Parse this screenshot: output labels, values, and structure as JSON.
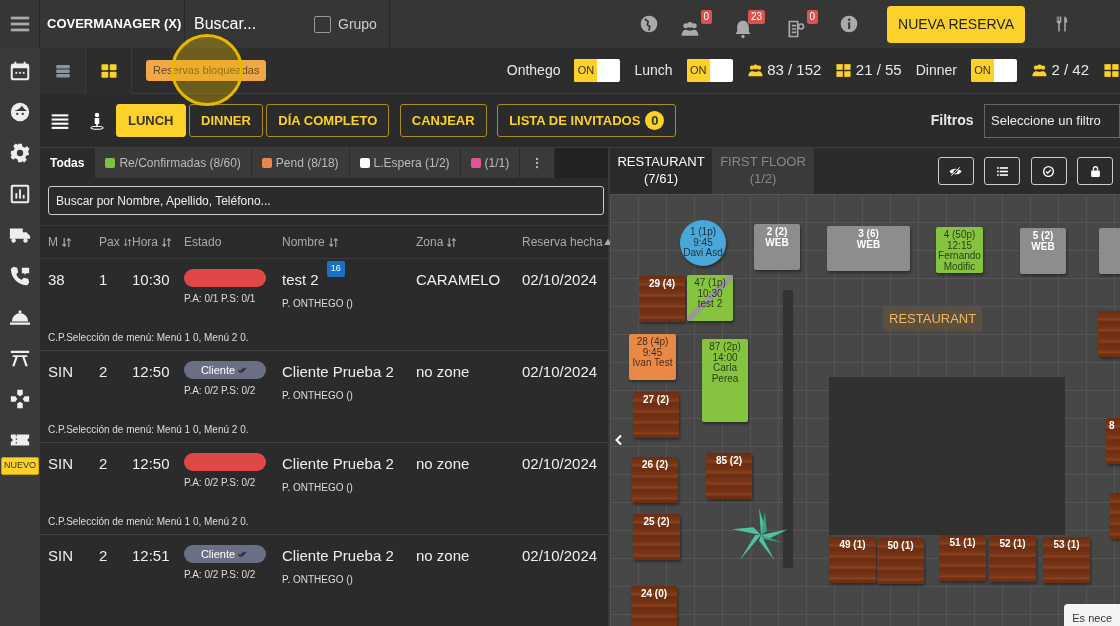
{
  "topbar": {
    "brand": "COVERMANAGER (X)",
    "search": {
      "placeholder": "Buscar..."
    },
    "group": {
      "label": "Grupo",
      "checked": false
    },
    "icons": [
      {
        "kind": "globe"
      },
      {
        "kind": "people",
        "count": "0"
      },
      {
        "kind": "bell",
        "count": "23"
      },
      {
        "kind": "clipboard",
        "count": "0"
      },
      {
        "kind": "info"
      }
    ],
    "new_button": "NUEVA RESERVA"
  },
  "sidebar": {
    "items": [
      {
        "kind": "calendar"
      },
      {
        "kind": "face"
      },
      {
        "kind": "gear"
      },
      {
        "kind": "chart"
      },
      {
        "kind": "truck"
      },
      {
        "kind": "phone"
      },
      {
        "kind": "service-bell"
      },
      {
        "kind": "gate"
      },
      {
        "kind": "puzzle"
      },
      {
        "kind": "ticket",
        "badge": "NUEVO"
      }
    ]
  },
  "toolbar": {
    "views": [
      {
        "kind": "rows",
        "selected": false
      },
      {
        "kind": "grid",
        "selected": true
      }
    ],
    "blocked_tag": "Reservas bloqueadas",
    "services": [
      {
        "label": "Onthego",
        "toggle": "ON",
        "on": true
      },
      {
        "label": "Lunch",
        "toggle": "ON",
        "on": true,
        "stats": [
          {
            "kind": "people",
            "text": "83 / 152"
          },
          {
            "kind": "tables",
            "text": "21 / 55"
          }
        ]
      },
      {
        "label": "Dinner",
        "toggle": "ON",
        "on": true,
        "stats": [
          {
            "kind": "people",
            "text": "2 / 42"
          },
          {
            "kind": "tables"
          }
        ]
      }
    ]
  },
  "shifts": [
    {
      "label": "LUNCH",
      "selected": true
    },
    {
      "label": "DINNER",
      "selected": false
    },
    {
      "label": "DÍA COMPLETO",
      "selected": false
    }
  ],
  "actions": [
    {
      "label": "CANJEAR"
    },
    {
      "label": "LISTA DE INVITADOS",
      "count": "0"
    }
  ],
  "filters": {
    "label": "Filtros",
    "placeholder": "Seleccione un filtro"
  },
  "list": {
    "tabs": [
      {
        "label": "Todas",
        "selected": true
      },
      {
        "label": "Re/Confirmadas (8/60)",
        "color": "#7dc242",
        "selected": false
      },
      {
        "label": "Pend (8/18)",
        "color": "#e8894a",
        "selected": false
      },
      {
        "label": "L.Espera (1/2)",
        "color": "#ffffff",
        "selected": false
      },
      {
        "label": "(1/1)",
        "color": "#e0559a",
        "selected": false
      }
    ],
    "search": {
      "placeholder": "Buscar por Nombre, Apellido, Teléfono..."
    },
    "columns": [
      {
        "label": "M",
        "sortable": true
      },
      {
        "label": "Pax",
        "sortable": true
      },
      {
        "label": "Hora",
        "sortable": true
      },
      {
        "label": "Estado",
        "sortable": false
      },
      {
        "label": "Nombre",
        "sortable": true
      },
      {
        "label": "Zona",
        "sortable": true
      },
      {
        "label": "Reserva hecha",
        "sortable": false,
        "sorted_ascending": true
      }
    ],
    "rows": [
      {
        "m": "38",
        "pax": "1",
        "hora": "10:30",
        "status": {
          "color": "#e04848"
        },
        "payments": "P.A: 0/1  P.S: 0/1",
        "name": "test 2",
        "badge": "16",
        "origin": "P. ONTHEGO ()",
        "zone": "CARAMELO",
        "date": "02/10/2024",
        "note": "C.P.Selección de menú: Menú 1 0, Menú 2 0."
      },
      {
        "m": "SIN",
        "pax": "2",
        "hora": "12:50",
        "status": {
          "color": "#6b6f86",
          "label": "Cliente",
          "read": true
        },
        "payments": "P.A: 0/2  P.S: 0/2",
        "name": "Cliente Prueba 2",
        "origin": "P. ONTHEGO ()",
        "zone": "no zone",
        "date": "02/10/2024",
        "note": "C.P.Selección de menú: Menú 1 0, Menú 2 0."
      },
      {
        "m": "SIN",
        "pax": "2",
        "hora": "12:50",
        "status": {
          "color": "#e04848"
        },
        "payments": "P.A: 0/2  P.S: 0/2",
        "name": "Cliente Prueba 2",
        "origin": "P. ONTHEGO ()",
        "zone": "no zone",
        "date": "02/10/2024",
        "note": "C.P.Selección de menú: Menú 1 0, Menú 2 0."
      },
      {
        "m": "SIN",
        "pax": "2",
        "hora": "12:51",
        "status": {
          "color": "#6b6f86",
          "label": "Cliente",
          "read": true
        },
        "payments": "P.A: 0/2  P.S: 0/2",
        "name": "Cliente Prueba 2",
        "origin": "P. ONTHEGO ()",
        "zone": "no zone",
        "date": "02/10/2024"
      }
    ]
  },
  "floor": {
    "tabs": [
      {
        "label": "RESTAURANT",
        "count": "(7/61)",
        "selected": true
      },
      {
        "label": "FIRST FLOOR",
        "count": "(1/2)",
        "selected": false
      }
    ],
    "tools": [
      {
        "kind": "eye-off"
      },
      {
        "kind": "list"
      },
      {
        "kind": "check-circle"
      },
      {
        "kind": "lock"
      }
    ],
    "zone_label": "RESTAURANT",
    "tables": [
      {
        "kind": "round",
        "color": "#4aa8d8",
        "lines": [
          "1 (1p)",
          "9:45",
          "Davi Asd"
        ]
      },
      {
        "kind": "square",
        "color": "#8d8d8d",
        "lines": [
          "2 (2)",
          "WEB"
        ]
      },
      {
        "kind": "square",
        "color": "#8d8d8d",
        "lines": [
          "3 (6)",
          "WEB"
        ]
      },
      {
        "kind": "square",
        "color": "#86c440",
        "lines": [
          "4 (50p)",
          "12:15",
          "Fernando",
          "Modific"
        ]
      },
      {
        "kind": "square",
        "color": "#8d8d8d",
        "lines": [
          "5 (2)",
          "WEB"
        ]
      },
      {
        "kind": "square",
        "color": "#8d8d8d"
      },
      {
        "kind": "wood",
        "lines": [
          "29 (4)"
        ]
      },
      {
        "kind": "square",
        "color": "#86c440",
        "struck": true,
        "lines": [
          "47 (1p)",
          "10:30",
          "test 2"
        ]
      },
      {
        "kind": "square",
        "color": "#e88a46",
        "lines": [
          "28 (4p)",
          "9:45",
          "Ivan Test"
        ]
      },
      {
        "kind": "square",
        "color": "#86c440",
        "lines": [
          "87 (2p)",
          "14:00",
          "Carla",
          "Perea"
        ]
      },
      {
        "kind": "wood",
        "lines": [
          "27 (2)"
        ]
      },
      {
        "kind": "wood",
        "lines": [
          "26 (2)"
        ]
      },
      {
        "kind": "wood",
        "lines": [
          "85 (2)"
        ]
      },
      {
        "kind": "wood",
        "lines": [
          "25 (2)"
        ]
      },
      {
        "kind": "wood",
        "lines": [
          "24 (0)"
        ]
      },
      {
        "kind": "wood",
        "lines": [
          "49 (1)"
        ]
      },
      {
        "kind": "wood",
        "lines": [
          "50 (1)"
        ]
      },
      {
        "kind": "wood",
        "lines": [
          "51 (1)"
        ]
      },
      {
        "kind": "wood",
        "lines": [
          "52 (1)"
        ]
      },
      {
        "kind": "wood",
        "lines": [
          "53 (1)"
        ]
      },
      {
        "kind": "wood"
      },
      {
        "kind": "wood",
        "lines": [
          "8"
        ]
      },
      {
        "kind": "wood"
      }
    ],
    "tooltip": "Es nece"
  }
}
